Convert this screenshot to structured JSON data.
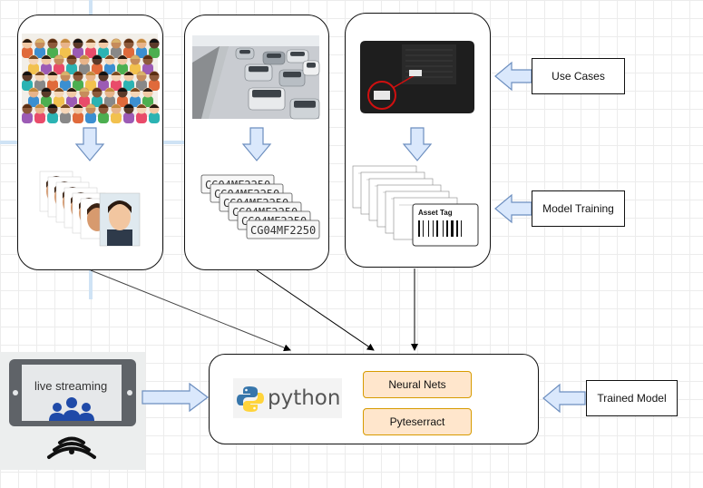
{
  "side_labels": {
    "use_cases": "Use Cases",
    "model_training": "Model Training",
    "trained_model": "Trained Model"
  },
  "central": {
    "logo_text": "python",
    "chips": [
      "Neural Nets",
      "Pyteserract"
    ]
  },
  "streaming": {
    "label": "live streaming"
  },
  "plates": {
    "text": "CG04MF2250"
  },
  "asset_tag": {
    "label": "Asset Tag"
  },
  "colors": {
    "arrow_fill": "#dae8fc",
    "arrow_stroke": "#6c8ebf",
    "chip_fill": "#ffe6cc",
    "chip_stroke": "#d79b00",
    "python_blue": "#3776ab",
    "python_yellow": "#ffd43b"
  }
}
